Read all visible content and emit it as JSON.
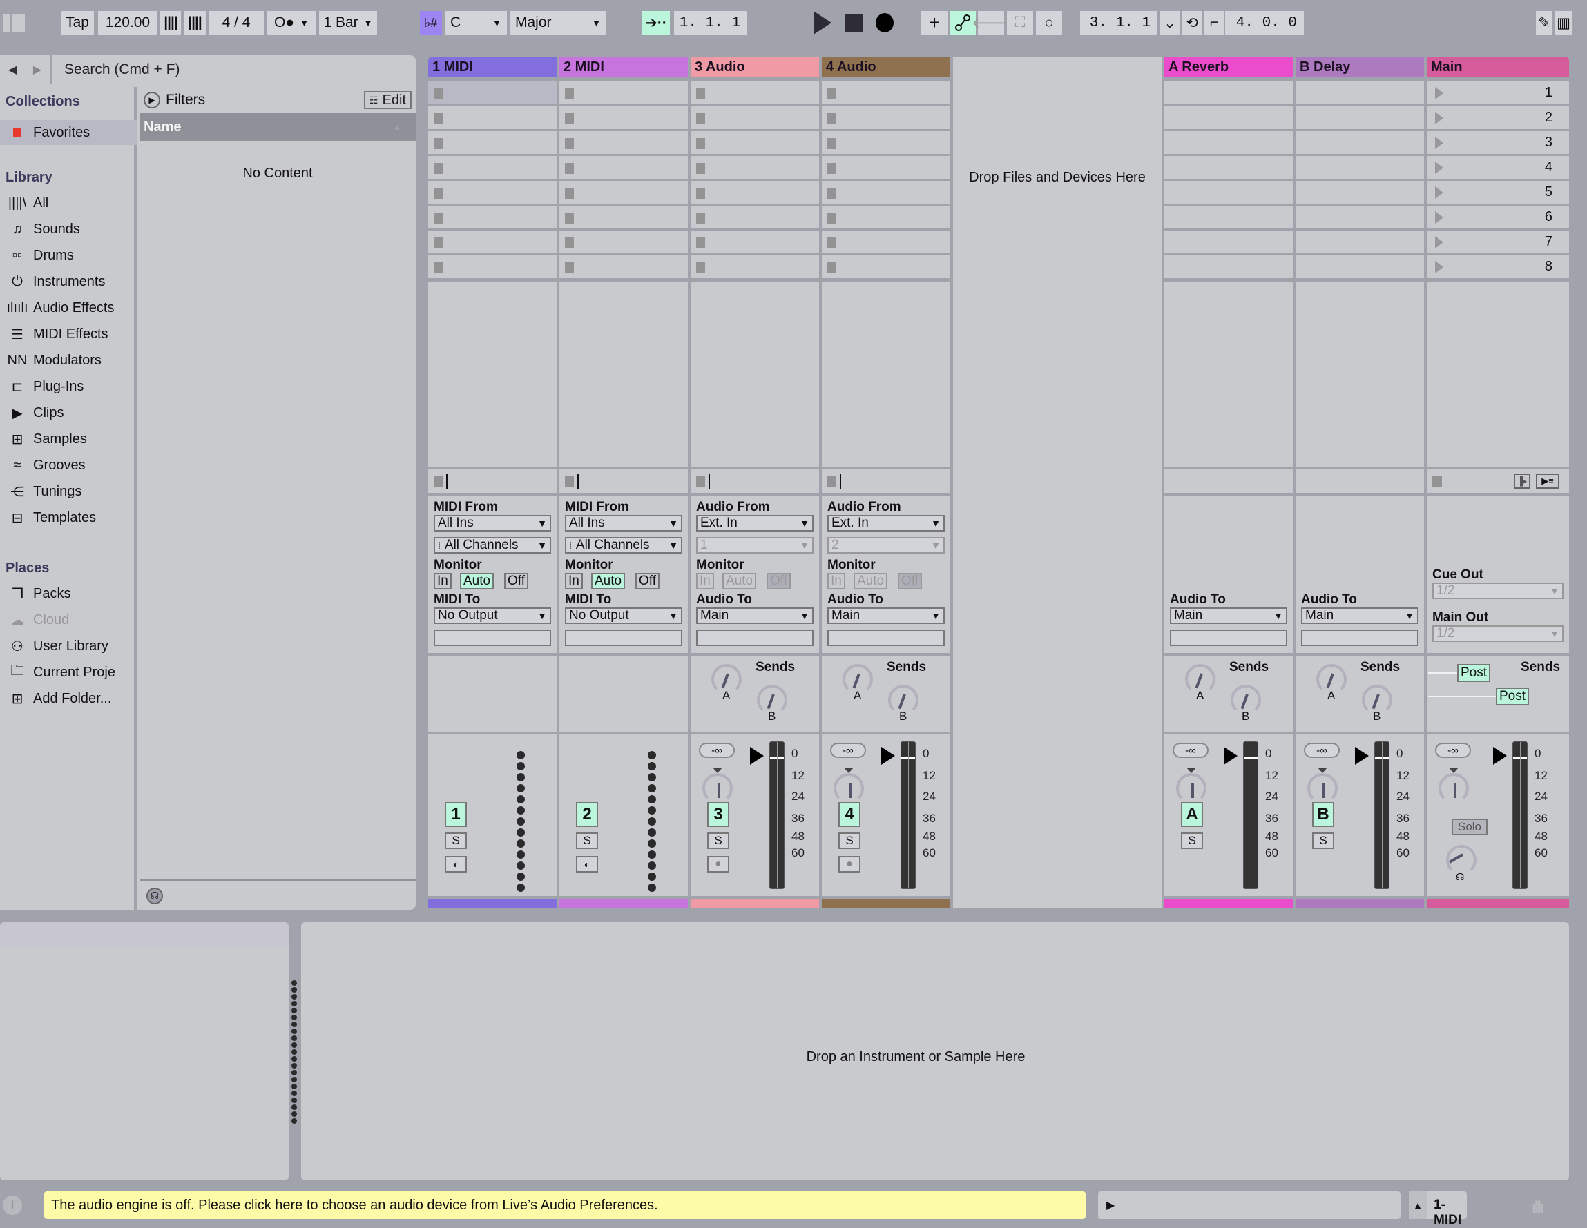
{
  "toolbar": {
    "tap": "Tap",
    "tempo": "120.00",
    "time_signature": "4 / 4",
    "metronome_label": "O●",
    "quantize": "1 Bar",
    "key_icon": "♭#",
    "key": "C",
    "scale": "Major",
    "arrangement_position": "1.  1.  1",
    "loop_start": "3.  1.  1",
    "loop_length": "4.  0.  0"
  },
  "browser": {
    "search_placeholder": "Search (Cmd + F)",
    "collections_title": "Collections",
    "favorites": "Favorites",
    "library_title": "Library",
    "library_items": [
      "All",
      "Sounds",
      "Drums",
      "Instruments",
      "Audio Effects",
      "MIDI Effects",
      "Modulators",
      "Plug-Ins",
      "Clips",
      "Samples",
      "Grooves",
      "Tunings",
      "Templates"
    ],
    "places_title": "Places",
    "places_items": [
      "Packs",
      "Cloud",
      "User Library",
      "Current Proje",
      "Add Folder..."
    ],
    "filters": "Filters",
    "edit": "Edit",
    "name_header": "Name",
    "no_content": "No Content"
  },
  "tracks": [
    {
      "name": "1 MIDI",
      "color": "#826fdd",
      "type": "midi",
      "from_label": "MIDI From",
      "from": "All Ins",
      "channel": "All Channels",
      "to_label": "MIDI To",
      "to": "No Output",
      "number": "1",
      "monitor_active": "Auto"
    },
    {
      "name": "2 MIDI",
      "color": "#c874de",
      "type": "midi",
      "from_label": "MIDI From",
      "from": "All Ins",
      "channel": "All Channels",
      "to_label": "MIDI To",
      "to": "No Output",
      "number": "2",
      "monitor_active": "Auto"
    },
    {
      "name": "3 Audio",
      "color": "#f09aa6",
      "type": "audio",
      "from_label": "Audio From",
      "from": "Ext. In",
      "channel": "1",
      "to_label": "Audio To",
      "to": "Main",
      "number": "3",
      "monitor_active": "Off"
    },
    {
      "name": "4 Audio",
      "color": "#8f7150",
      "type": "audio",
      "from_label": "Audio From",
      "from": "Ext. In",
      "channel": "2",
      "to_label": "Audio To",
      "to": "Main",
      "number": "4",
      "monitor_active": "Off"
    }
  ],
  "returns": [
    {
      "name": "A Reverb",
      "color": "#eb4ccb",
      "to_label": "Audio To",
      "to": "Main",
      "letter": "A"
    },
    {
      "name": "B Delay",
      "color": "#ae7abf",
      "to_label": "Audio To",
      "to": "Main",
      "letter": "B"
    }
  ],
  "main": {
    "name": "Main",
    "color": "#d65b9a",
    "scenes": [
      "1",
      "2",
      "3",
      "4",
      "5",
      "6",
      "7",
      "8"
    ],
    "cue_out_label": "Cue Out",
    "cue_out": "1/2",
    "main_out_label": "Main Out",
    "main_out": "1/2",
    "post1": "Post",
    "post2": "Post",
    "solo": "Solo"
  },
  "mixer": {
    "monitor_options": [
      "In",
      "Auto",
      "Off"
    ],
    "monitor_label": "Monitor",
    "sends_label": "Sends",
    "send_a": "A",
    "send_b": "B",
    "solo_button": "S",
    "volume": "-∞",
    "meter_scale": [
      "0",
      "12",
      "24",
      "36",
      "48",
      "60"
    ]
  },
  "drop_files": "Drop Files and Devices Here",
  "detail": {
    "drop_instrument": "Drop an Instrument or Sample Here"
  },
  "status": {
    "message": "The audio engine is off. Please click here to choose an audio device from Live’s Audio Preferences.",
    "selected_track": "1-MIDI"
  }
}
